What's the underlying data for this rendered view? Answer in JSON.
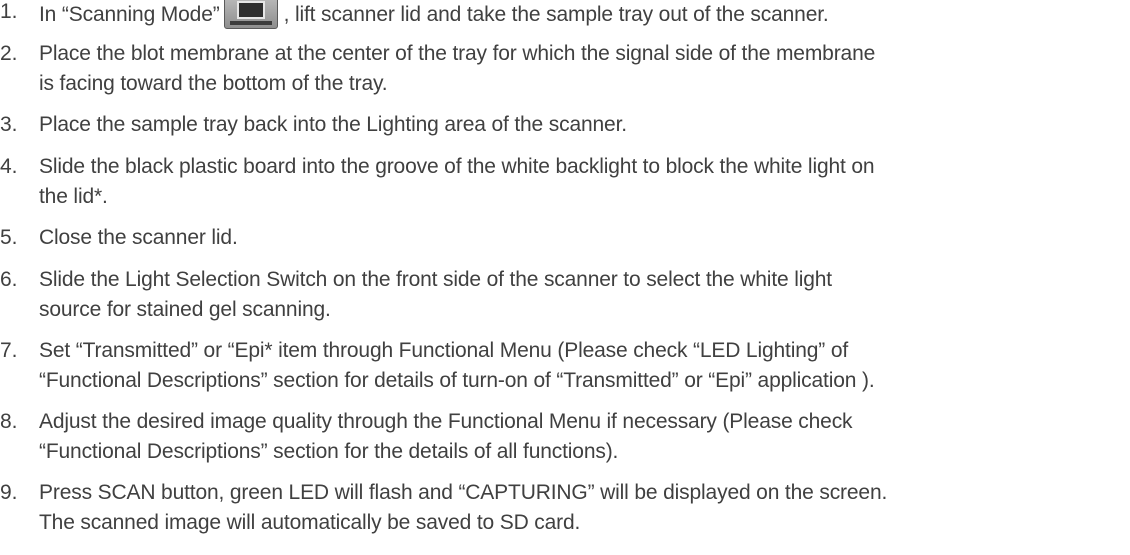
{
  "steps": [
    {
      "num": "1.",
      "text_before": "In “Scanning Mode”",
      "icon": "scanner-mode-icon",
      "text_after": ", lift scanner lid and take the sample tray out of the scanner."
    },
    {
      "num": "2.",
      "lines": [
        "Place the blot membrane at the center of the tray for which the signal side of the membrane",
        "is facing toward the bottom of the tray."
      ]
    },
    {
      "num": "3.",
      "lines": [
        "Place the sample tray back into the Lighting area of the scanner."
      ]
    },
    {
      "num": "4.",
      "lines": [
        "Slide the black plastic board into the groove of the white backlight to block the white light on",
        "the lid*."
      ]
    },
    {
      "num": "5.",
      "lines": [
        "Close the scanner lid."
      ]
    },
    {
      "num": "6.",
      "lines": [
        "Slide the Light Selection Switch on the front side of the scanner to select the white light",
        "source for stained gel scanning."
      ]
    },
    {
      "num": "7.",
      "lines": [
        "Set “Transmitted” or “Epi* item through Functional Menu (Please check “LED Lighting” of",
        "“Functional Descriptions” section for details of turn-on of “Transmitted” or “Epi” application )."
      ]
    },
    {
      "num": "8.",
      "lines": [
        "Adjust the desired image quality through the Functional Menu if necessary (Please check",
        "“Functional Descriptions” section for the details of all functions)."
      ]
    },
    {
      "num": "9.",
      "lines": [
        "Press SCAN button, green LED will flash and “CAPTURING” will be displayed on the screen.",
        "The scanned image will automatically be saved to SD card."
      ]
    }
  ]
}
